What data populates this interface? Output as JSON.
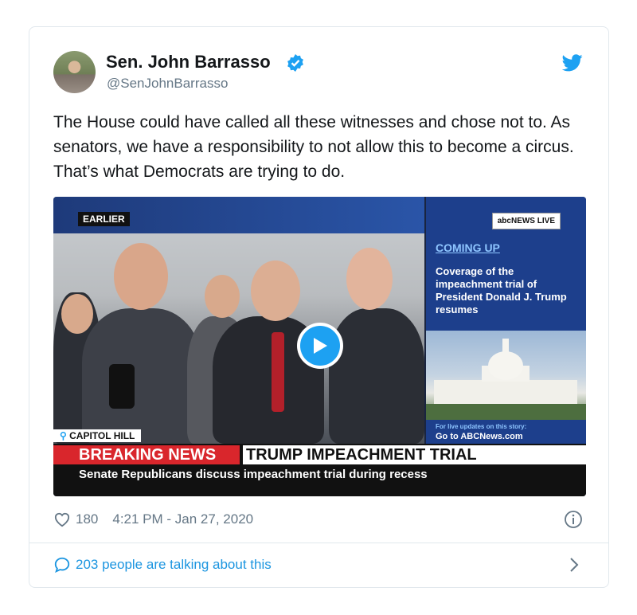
{
  "user": {
    "display_name": "Sen. John Barrasso",
    "handle": "@SenJohnBarrasso",
    "verified_icon": "verified-badge-icon"
  },
  "tweet": {
    "text": "The House could have called all these witnesses and chose not to. As senators, we have a responsibility to not allow this to become a circus. That’s what Democrats are trying to do."
  },
  "media": {
    "earlier_label": "EARLIER",
    "network_badge": "abcNEWS LIVE",
    "coming_up": "COMING UP",
    "coverage_text": "Coverage of the impeachment trial of President Donald J. Trump resumes",
    "updates_small": "For live updates on this story:",
    "updates_link": "Go to ABCNews.com",
    "location": "CAPITOL HILL",
    "breaking_label": "BREAKING NEWS",
    "ticker_title": "TRUMP IMPEACHMENT TRIAL",
    "ticker_subtitle": "Senate Republicans discuss impeachment trial during recess"
  },
  "footer": {
    "likes": "180",
    "timestamp": "4:21 PM - Jan 27, 2020",
    "talking": "203 people are talking about this"
  },
  "colors": {
    "accent": "#1da1f2",
    "link": "#1b95e0",
    "muted": "#657786",
    "breaking_red": "#d9262c"
  }
}
